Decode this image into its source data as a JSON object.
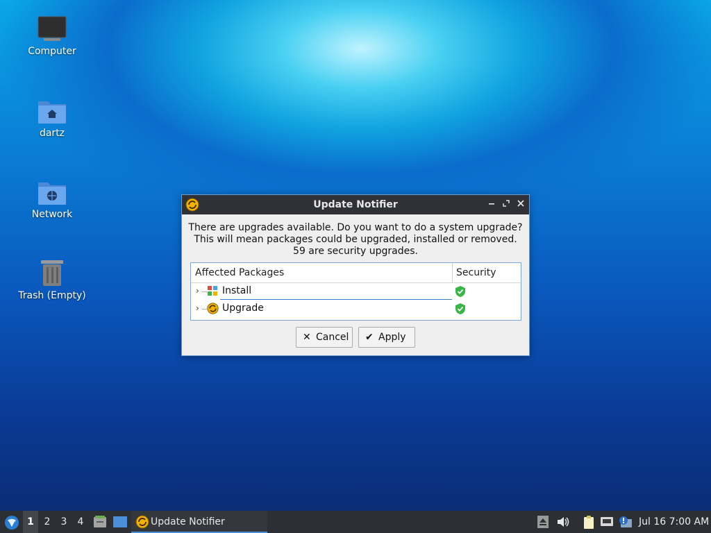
{
  "desktop": {
    "icons": [
      {
        "label": "Computer"
      },
      {
        "label": "dartz"
      },
      {
        "label": "Network"
      },
      {
        "label": "Trash (Empty)"
      }
    ]
  },
  "dialog": {
    "title": "Update Notifier",
    "message_lines": [
      "There are upgrades available. Do you want to do a system upgrade?",
      "This will mean packages could be upgraded, installed or removed.",
      "59 are security upgrades."
    ],
    "tree": {
      "columns": [
        "Affected Packages",
        "Security"
      ],
      "rows": [
        {
          "label": "Install",
          "icon": "install-icon",
          "security": "shield-check-icon"
        },
        {
          "label": "Upgrade",
          "icon": "upgrade-icon",
          "security": "shield-check-icon"
        }
      ]
    },
    "buttons": {
      "cancel": "Cancel",
      "apply": "Apply"
    }
  },
  "taskbar": {
    "workspaces": [
      "1",
      "2",
      "3",
      "4"
    ],
    "active_workspace": "1",
    "task_label": "Update Notifier",
    "clock": "Jul 16 7:00 AM"
  },
  "colors": {
    "titlebar": "#2f3136",
    "accent": "#4a90d9",
    "shield": "#3bb54a",
    "upgrade_icon": "#f2b200"
  }
}
